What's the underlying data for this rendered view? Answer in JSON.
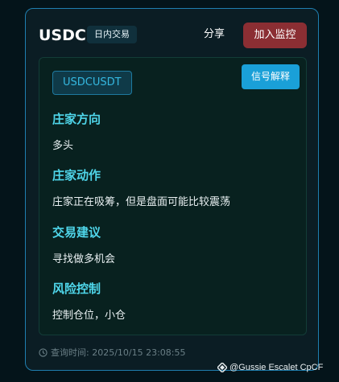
{
  "header": {
    "symbol": "USDC",
    "badge": "日内交易",
    "share_label": "分享",
    "add_label": "加入监控"
  },
  "panel": {
    "pair": "USDCUSDT",
    "signal_button": "信号解释",
    "sections": [
      {
        "title": "庄家方向",
        "value": "多头"
      },
      {
        "title": "庄家动作",
        "value": "庄家正在吸筹，但是盘面可能比较震荡"
      },
      {
        "title": "交易建议",
        "value": "寻找做多机会"
      },
      {
        "title": "风险控制",
        "value": "控制仓位，小仓"
      }
    ]
  },
  "footer": {
    "query_time": "查询时间: 2025/10/15 23:08:55"
  },
  "watermark": {
    "text": "@Gussie Escalet CpCF"
  },
  "icons": {
    "clock": "clock-icon",
    "watermark_logo": "diamond-logo-icon"
  },
  "colors": {
    "accent": "#4fd6ea",
    "danger": "#8b2e33",
    "primary": "#1aa0d8"
  }
}
